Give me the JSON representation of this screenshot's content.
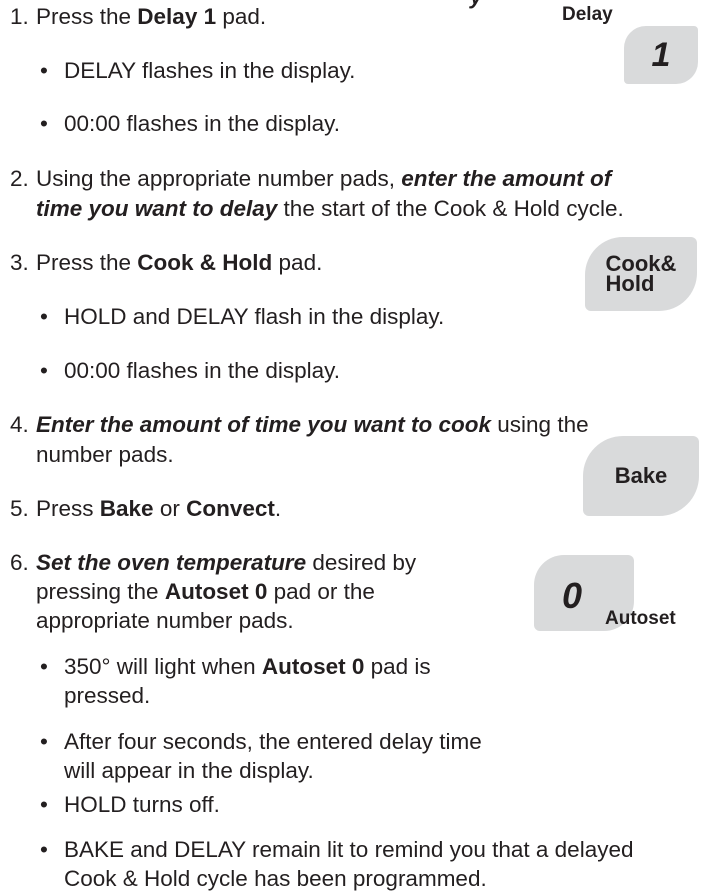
{
  "heading_fragment": "y",
  "steps": [
    {
      "num": "1.",
      "lines": [
        [
          "Press the ",
          {
            "b": "Delay 1"
          },
          " pad."
        ]
      ]
    },
    {
      "num": "2.",
      "lines": [
        [
          "Using the appropriate number pads, ",
          {
            "bi": "enter the amount of"
          }
        ],
        [
          {
            "bi": "time you want to delay"
          },
          " the start of the Cook & Hold cycle."
        ]
      ]
    },
    {
      "num": "3.",
      "lines": [
        [
          "Press the ",
          {
            "b": "Cook & Hold"
          },
          " pad."
        ]
      ]
    },
    {
      "num": "4.",
      "lines": [
        [
          {
            "bi": "Enter the amount of time you want to cook"
          },
          " using the"
        ],
        [
          "number pads."
        ]
      ]
    },
    {
      "num": "5.",
      "lines": [
        [
          "Press ",
          {
            "b": "Bake"
          },
          " or ",
          {
            "b": "Convect"
          },
          "."
        ]
      ]
    },
    {
      "num": "6.",
      "lines": [
        [
          {
            "bi": "Set the oven temperature"
          },
          " desired by"
        ],
        [
          "pressing the ",
          {
            "b": "Autoset 0"
          },
          " pad or the"
        ],
        [
          "appropriate number pads."
        ]
      ]
    }
  ],
  "bullets": {
    "step1": [
      "DELAY flashes in the display.",
      "00:00 flashes in the display."
    ],
    "step3": [
      "HOLD and DELAY flash in the display.",
      "00:00 flashes in the display."
    ],
    "step6": [
      [
        [
          "350° will light when ",
          {
            "b": "Autoset 0"
          },
          " pad is"
        ],
        [
          "pressed."
        ]
      ],
      [
        [
          "After four seconds, the entered delay time"
        ],
        [
          "will appear in the display."
        ]
      ],
      [
        [
          "HOLD turns off."
        ]
      ],
      [
        [
          "BAKE and DELAY remain lit to remind you that a delayed"
        ],
        [
          "Cook & Hold cycle has been programmed."
        ]
      ]
    ]
  },
  "pads": {
    "delay": {
      "label": "Delay",
      "key": "1"
    },
    "cook_hold": {
      "label": "Cook&\nHold"
    },
    "bake": {
      "label": "Bake"
    },
    "autoset": {
      "key": "0",
      "label": "Autoset"
    }
  },
  "colors": {
    "text": "#231f20",
    "pad": "#d9dadb"
  }
}
